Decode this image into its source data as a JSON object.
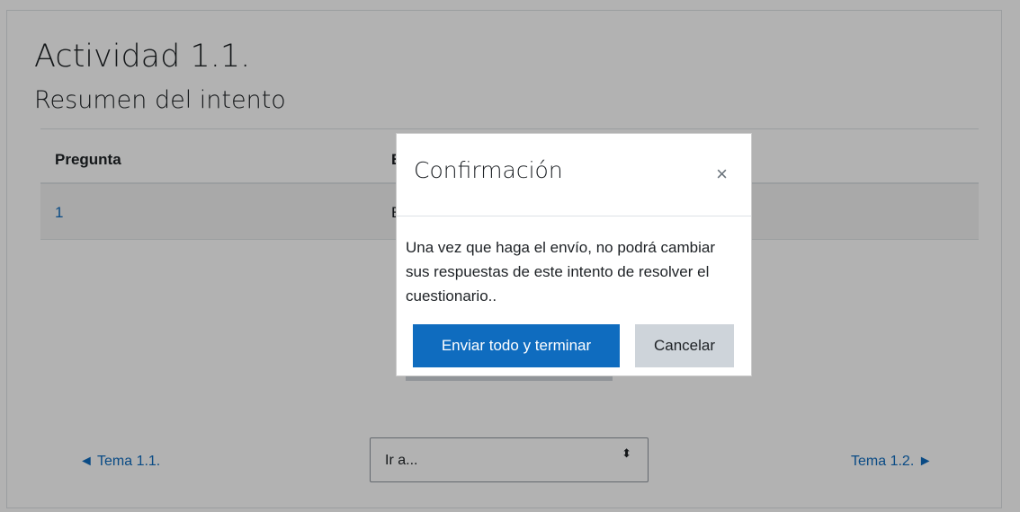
{
  "page": {
    "title": "Actividad 1.1.",
    "subtitle": "Resumen del intento"
  },
  "table": {
    "headers": [
      "Pregunta",
      "E"
    ],
    "rows": [
      {
        "number": "1",
        "status": "E"
      }
    ]
  },
  "navigation": {
    "prev_label": "◄ Tema 1.1.",
    "next_label": "Tema 1.2. ►",
    "jump_label": "Ir a...",
    "jump_arrows": "⬍"
  },
  "modal": {
    "title": "Confirmación",
    "close_glyph": "×",
    "body": "Una vez que haga el envío, no podrá cambiar sus respuestas de este intento de resolver el cuestionario..",
    "confirm_label": "Enviar todo y terminar",
    "cancel_label": "Cancelar"
  },
  "colors": {
    "accent": "#0f6cbf",
    "secondary_button": "#ced4da",
    "row_highlight": "#f2f2f2",
    "backdrop": "rgba(0,0,0,0.30)"
  }
}
